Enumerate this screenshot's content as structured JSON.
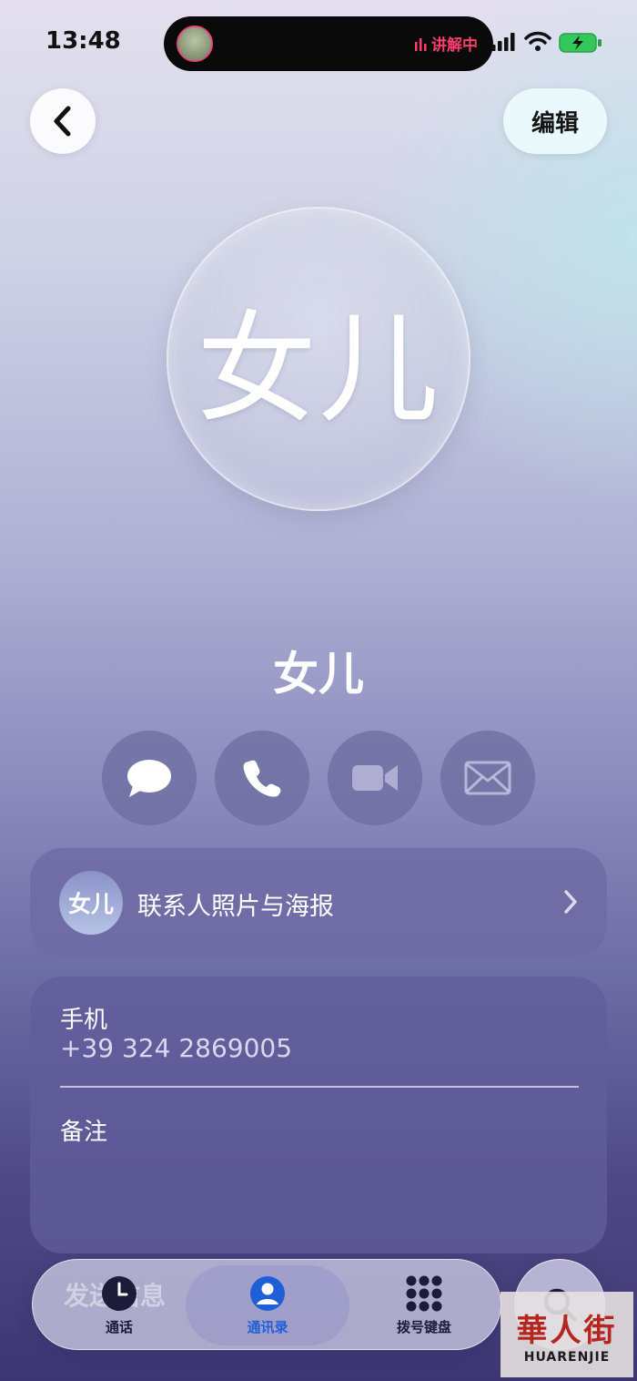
{
  "status_bar": {
    "time": "13:48",
    "live_text": "讲解中",
    "live_color": "#ff3d6e"
  },
  "header": {
    "back_icon": "chevron-left-icon",
    "edit_label": "编辑"
  },
  "contact": {
    "avatar_text": "女儿",
    "name": "女儿"
  },
  "actions": [
    {
      "icon": "message-icon"
    },
    {
      "icon": "phone-icon"
    },
    {
      "icon": "video-icon"
    },
    {
      "icon": "mail-icon"
    }
  ],
  "poster_card": {
    "avatar_text": "女儿",
    "label": "联系人照片与海报",
    "chevron_icon": "chevron-right-icon"
  },
  "info_card": {
    "phone_label": "手机",
    "phone_value": "+39 324 2869005",
    "notes_label": "备注"
  },
  "tab_bar": {
    "ghost_text": "发送信息",
    "tabs": [
      {
        "label": "通话",
        "icon": "clock-icon",
        "selected": false
      },
      {
        "label": "通讯录",
        "icon": "person-icon",
        "selected": true
      },
      {
        "label": "拨号键盘",
        "icon": "keypad-icon",
        "selected": false
      }
    ],
    "accent_color": "#1e5fd8"
  },
  "search": {
    "icon": "search-icon"
  },
  "watermark": {
    "text_cn": "華人街",
    "text_en": "HUARENJIE"
  }
}
